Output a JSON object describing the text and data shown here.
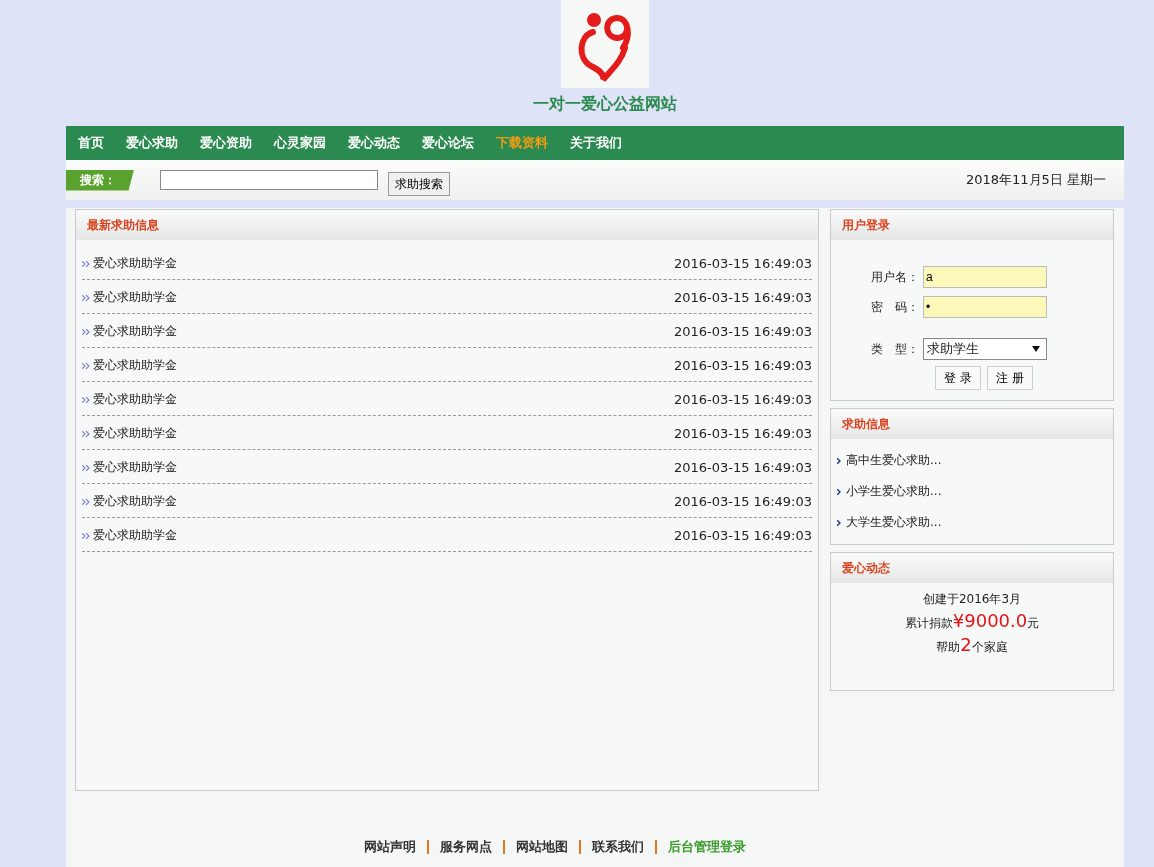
{
  "site_title": "一对一爱心公益网站",
  "nav": [
    {
      "label": "首页",
      "selected": false
    },
    {
      "label": "爱心求助",
      "selected": false
    },
    {
      "label": "爱心资助",
      "selected": false
    },
    {
      "label": "心灵家园",
      "selected": false
    },
    {
      "label": "爱心动态",
      "selected": false
    },
    {
      "label": "爱心论坛",
      "selected": false
    },
    {
      "label": "下载资料",
      "selected": true
    },
    {
      "label": "关于我们",
      "selected": false
    }
  ],
  "search": {
    "label": "搜索：",
    "button": "求助搜索"
  },
  "date": "2018年11月5日 星期一",
  "latest": {
    "title": "最新求助信息",
    "items": [
      {
        "title": "爱心求助助学金",
        "time": "2016-03-15 16:49:03"
      },
      {
        "title": "爱心求助助学金",
        "time": "2016-03-15 16:49:03"
      },
      {
        "title": "爱心求助助学金",
        "time": "2016-03-15 16:49:03"
      },
      {
        "title": "爱心求助助学金",
        "time": "2016-03-15 16:49:03"
      },
      {
        "title": "爱心求助助学金",
        "time": "2016-03-15 16:49:03"
      },
      {
        "title": "爱心求助助学金",
        "time": "2016-03-15 16:49:03"
      },
      {
        "title": "爱心求助助学金",
        "time": "2016-03-15 16:49:03"
      },
      {
        "title": "爱心求助助学金",
        "time": "2016-03-15 16:49:03"
      },
      {
        "title": "爱心求助助学金",
        "time": "2016-03-15 16:49:03"
      }
    ]
  },
  "login": {
    "title": "用户登录",
    "username_label": "用户名：",
    "username": "a",
    "password_label": "密　码：",
    "password": "•",
    "type_label": "类　型：",
    "type": "求助学生",
    "buttons": [
      "登 录",
      "注 册"
    ]
  },
  "help_info": {
    "title": "求助信息",
    "items": [
      "高中生爱心求助...",
      "小学生爱心求助...",
      "大学生爱心求助..."
    ]
  },
  "news": {
    "title": "爱心动态",
    "lines": [
      [
        {
          "text": "创建于2016年3月",
          "emphasis": false
        }
      ],
      [
        {
          "text": "累计捐款",
          "emphasis": false
        },
        {
          "text": "¥9000.0",
          "emphasis": true
        },
        {
          "text": "元",
          "emphasis": false
        }
      ],
      [
        {
          "text": "帮助",
          "emphasis": false
        },
        {
          "text": "2",
          "emphasis": true
        },
        {
          "text": "个家庭",
          "emphasis": false
        }
      ]
    ]
  },
  "footer": [
    {
      "label": "网站声明",
      "kind": "normal"
    },
    {
      "label": "服务网点",
      "kind": "normal"
    },
    {
      "label": "网站地图",
      "kind": "normal"
    },
    {
      "label": "联系我们",
      "kind": "normal"
    },
    {
      "label": "后台管理登录",
      "kind": "admin"
    }
  ]
}
